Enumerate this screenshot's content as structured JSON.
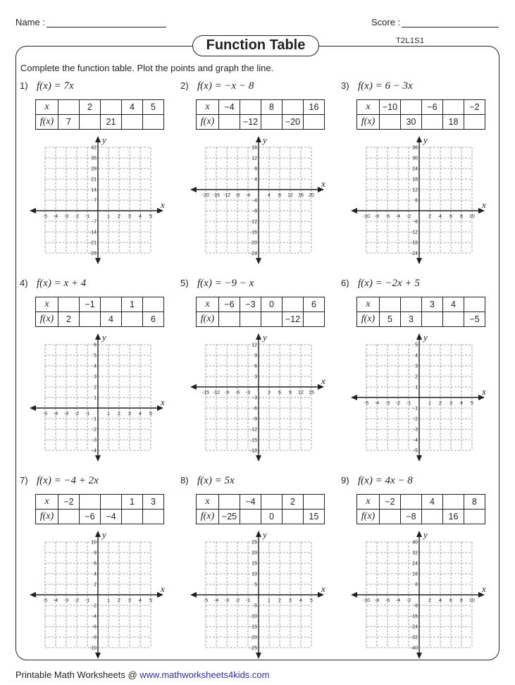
{
  "header": {
    "name_label": "Name :",
    "score_label": "Score :",
    "title": "Function Table",
    "code": "T2L1S1",
    "instruction": "Complete the function table. Plot the points and graph the line."
  },
  "problems": [
    {
      "number": "1)",
      "function": "f(x) = 7x",
      "table": {
        "x_label": "x",
        "fx_label": "f(x)",
        "x": [
          "",
          "2",
          "",
          "4",
          "5"
        ],
        "fx": [
          "7",
          "",
          "21",
          "",
          ""
        ]
      },
      "grid": {
        "x_ticks": [
          "-5",
          "-4",
          "-3",
          "-2",
          "-1",
          "1",
          "2",
          "3",
          "4",
          "5"
        ],
        "y_ticks_pos": [
          "7",
          "14",
          "21",
          "28",
          "35",
          "42"
        ],
        "y_ticks_neg": [
          "-7",
          "-14",
          "-21",
          "-28"
        ],
        "x_label": "x",
        "y_label": "y"
      }
    },
    {
      "number": "2)",
      "function": "f(x) = −x − 8",
      "table": {
        "x_label": "x",
        "fx_label": "f(x)",
        "x": [
          "−4",
          "",
          "8",
          "",
          "16"
        ],
        "fx": [
          "",
          "−12",
          "",
          "−20",
          ""
        ]
      },
      "grid": {
        "x_ticks": [
          "-20",
          "-16",
          "-12",
          "-8",
          "-4",
          "4",
          "8",
          "12",
          "16",
          "20"
        ],
        "y_ticks_pos": [
          "4",
          "8",
          "12",
          "16"
        ],
        "y_ticks_neg": [
          "-4",
          "-8",
          "-12",
          "-16",
          "-20",
          "-24"
        ],
        "x_label": "x",
        "y_label": "y"
      }
    },
    {
      "number": "3)",
      "function": "f(x) = 6 − 3x",
      "table": {
        "x_label": "x",
        "fx_label": "f(x)",
        "x": [
          "−10",
          "",
          "−6",
          "",
          "−2"
        ],
        "fx": [
          "",
          "30",
          "",
          "18",
          ""
        ]
      },
      "grid": {
        "x_ticks": [
          "-10",
          "-8",
          "-6",
          "-4",
          "-2",
          "2",
          "4",
          "6",
          "8",
          "10"
        ],
        "y_ticks_pos": [
          "6",
          "12",
          "18",
          "24",
          "30",
          "36"
        ],
        "y_ticks_neg": [
          "-6",
          "-12",
          "-18",
          "-24"
        ],
        "x_label": "x",
        "y_label": "y"
      }
    },
    {
      "number": "4)",
      "function": "f(x) = x + 4",
      "table": {
        "x_label": "x",
        "fx_label": "f(x)",
        "x": [
          "",
          "−1",
          "",
          "1",
          ""
        ],
        "fx": [
          "2",
          "",
          "4",
          "",
          "6"
        ]
      },
      "grid": {
        "x_ticks": [
          "-5",
          "-4",
          "-3",
          "-2",
          "-1",
          "1",
          "2",
          "3",
          "4",
          "5"
        ],
        "y_ticks_pos": [
          "1",
          "2",
          "3",
          "4",
          "5",
          "6"
        ],
        "y_ticks_neg": [
          "-1",
          "-2",
          "-3",
          "-4"
        ],
        "x_label": "x",
        "y_label": "y"
      }
    },
    {
      "number": "5)",
      "function": "f(x) = −9 − x",
      "table": {
        "x_label": "x",
        "fx_label": "f(x)",
        "x": [
          "−6",
          "−3",
          "0",
          "",
          "6"
        ],
        "fx": [
          "",
          "",
          "",
          "−12",
          ""
        ]
      },
      "grid": {
        "x_ticks": [
          "-15",
          "-12",
          "-9",
          "-6",
          "-3",
          "3",
          "6",
          "9",
          "12",
          "15"
        ],
        "y_ticks_pos": [
          "3",
          "6",
          "9",
          "12"
        ],
        "y_ticks_neg": [
          "-3",
          "-6",
          "-9",
          "-12",
          "-15",
          "-18"
        ],
        "x_label": "x",
        "y_label": "y"
      }
    },
    {
      "number": "6)",
      "function": "f(x) = −2x + 5",
      "table": {
        "x_label": "x",
        "fx_label": "f(x)",
        "x": [
          "",
          "",
          "3",
          "4",
          ""
        ],
        "fx": [
          "5",
          "3",
          "",
          "",
          "−5"
        ]
      },
      "grid": {
        "x_ticks": [
          "-5",
          "-4",
          "-3",
          "-2",
          "-1",
          "1",
          "2",
          "3",
          "4",
          "5"
        ],
        "y_ticks_pos": [
          "1",
          "2",
          "3",
          "4",
          "5"
        ],
        "y_ticks_neg": [
          "-1",
          "-2",
          "-3",
          "-4",
          "-5"
        ],
        "x_label": "x",
        "y_label": "y"
      }
    },
    {
      "number": "7)",
      "function": "f(x) = −4 + 2x",
      "table": {
        "x_label": "x",
        "fx_label": "f(x)",
        "x": [
          "−2",
          "",
          "",
          "1",
          "3"
        ],
        "fx": [
          "",
          "−6",
          "−4",
          "",
          ""
        ]
      },
      "grid": {
        "x_ticks": [
          "-5",
          "-4",
          "-3",
          "-2",
          "-1",
          "1",
          "2",
          "3",
          "4",
          "5"
        ],
        "y_ticks_pos": [
          "2",
          "4",
          "6",
          "8",
          "10"
        ],
        "y_ticks_neg": [
          "-2",
          "-4",
          "-6",
          "-8",
          "-10"
        ],
        "x_label": "x",
        "y_label": "y"
      }
    },
    {
      "number": "8)",
      "function": "f(x) = 5x",
      "table": {
        "x_label": "x",
        "fx_label": "f(x)",
        "x": [
          "",
          "−4",
          "",
          "2",
          ""
        ],
        "fx": [
          "−25",
          "",
          "0",
          "",
          "15"
        ]
      },
      "grid": {
        "x_ticks": [
          "-5",
          "-4",
          "-3",
          "-2",
          "-1",
          "1",
          "2",
          "3",
          "4",
          "5"
        ],
        "y_ticks_pos": [
          "5",
          "10",
          "15",
          "20",
          "25"
        ],
        "y_ticks_neg": [
          "-5",
          "-10",
          "-15",
          "-20",
          "-25"
        ],
        "x_label": "x",
        "y_label": "y"
      }
    },
    {
      "number": "9)",
      "function": "f(x) = 4x − 8",
      "table": {
        "x_label": "x",
        "fx_label": "f(x)",
        "x": [
          "−2",
          "",
          "4",
          "",
          "8"
        ],
        "fx": [
          "",
          "−8",
          "",
          "16",
          ""
        ]
      },
      "grid": {
        "x_ticks": [
          "-10",
          "-8",
          "-6",
          "-4",
          "-2",
          "2",
          "4",
          "6",
          "8",
          "10"
        ],
        "y_ticks_pos": [
          "8",
          "16",
          "24",
          "32",
          "40"
        ],
        "y_ticks_neg": [
          "-8",
          "-16",
          "-24",
          "-32",
          "-40"
        ],
        "x_label": "x",
        "y_label": "y"
      }
    }
  ],
  "footer": {
    "prefix": "Printable Math Worksheets @ ",
    "link": "www.mathworksheets4kids.com",
    "link_color": "#2e3192"
  }
}
